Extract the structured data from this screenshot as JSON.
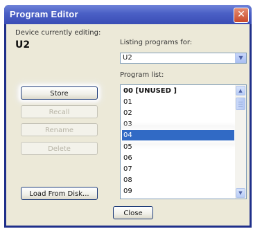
{
  "window": {
    "title": "Program Editor",
    "close_glyph": "✕"
  },
  "device": {
    "label": "Device currently editing:",
    "value": "U2"
  },
  "listing": {
    "label": "Listing programs for:",
    "selected": "U2"
  },
  "program_list": {
    "label": "Program list:",
    "items": [
      "00 [UNUSED  ]",
      "01",
      "02",
      "03",
      "04",
      "05",
      "06",
      "07",
      "08",
      "09"
    ],
    "selected_index": 4
  },
  "buttons": {
    "store": "Store",
    "recall": "Recall",
    "rename": "Rename",
    "delete": "Delete",
    "load_from_disk": "Load From Disk...",
    "close": "Close"
  },
  "icons": {
    "dropdown": "chevron-down-icon",
    "scroll_up": "arrow-up-icon",
    "scroll_down": "arrow-down-icon"
  },
  "colors": {
    "title_bar": "#4a5fc5",
    "selection": "#316ac5",
    "dialog_bg": "#ece9d8",
    "close_red": "#c9492b"
  }
}
